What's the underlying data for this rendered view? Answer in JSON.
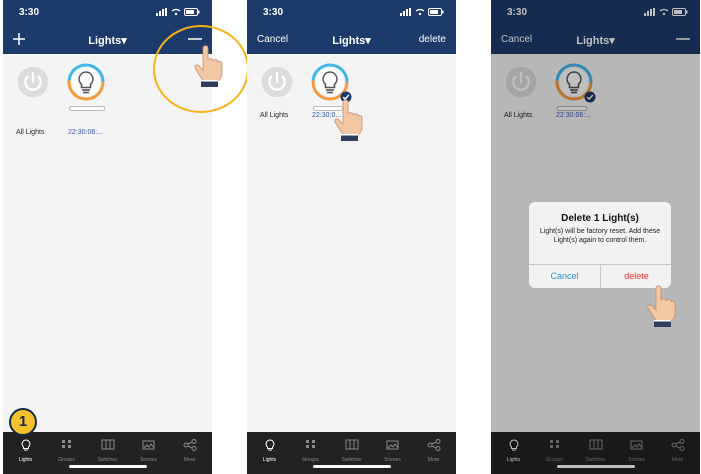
{
  "colors": {
    "navbar": "#1c3b6b",
    "tabbar": "#222222",
    "time_text": "#3355aa",
    "dialog_delete": "#e53935",
    "dialog_cancel": "#2a8fd6",
    "highlight": "#f6b21a",
    "badge": "#f6c22c"
  },
  "step": {
    "number": "1"
  },
  "panel1": {
    "status_time": "3:30",
    "nav_left_icon": "plus-icon",
    "title": "Lights▾",
    "nav_right_icon": "minus-icon",
    "devices": [
      {
        "label": "All Lights"
      },
      {
        "label": "22:30:06:..."
      }
    ],
    "tabs": [
      {
        "label": "Lights"
      },
      {
        "label": "Groups"
      },
      {
        "label": "Switches"
      },
      {
        "label": "Scenes"
      },
      {
        "label": "More"
      }
    ]
  },
  "panel2": {
    "status_time": "3:30",
    "nav_left": "Cancel",
    "title": "Lights▾",
    "nav_right": "delete",
    "devices": [
      {
        "label": "All Lights"
      },
      {
        "label": "22:30:0..."
      }
    ],
    "tabs": [
      {
        "label": "Lights"
      },
      {
        "label": "Groups"
      },
      {
        "label": "Switches"
      },
      {
        "label": "Scenes"
      },
      {
        "label": "More"
      }
    ]
  },
  "panel3": {
    "status_time": "3:30",
    "nav_left": "Cancel",
    "title": "Lights▾",
    "nav_right_icon": "minus-icon",
    "devices": [
      {
        "label": "All Lights"
      },
      {
        "label": "22:30:06:..."
      }
    ],
    "dialog": {
      "title": "Delete 1 Light(s)",
      "message": "Light(s) will be factory reset. Add these Light(s) again to control them.",
      "cancel": "Cancel",
      "delete": "delete"
    },
    "tabs": [
      {
        "label": "Lights"
      },
      {
        "label": "Groups"
      },
      {
        "label": "Switches"
      },
      {
        "label": "Scenes"
      },
      {
        "label": "More"
      }
    ]
  }
}
